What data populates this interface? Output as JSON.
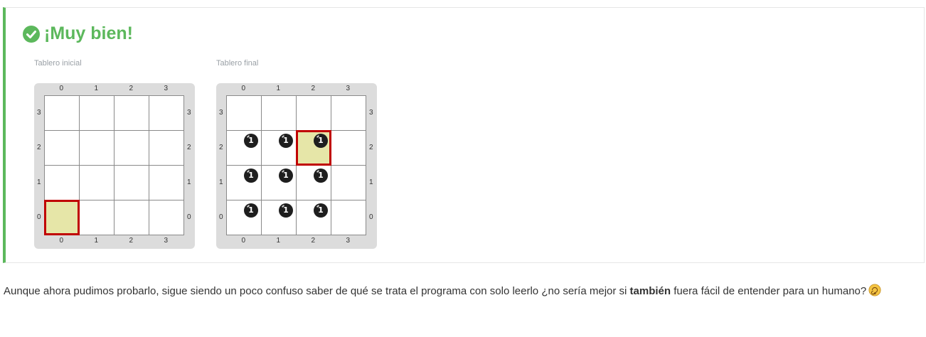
{
  "result": {
    "title": "¡Muy bien!",
    "colors": {
      "success": "#5cb85c",
      "cursor": "#c00000",
      "highlight": "#e6e6a8",
      "ball": "#1e1e1e"
    },
    "boards": [
      {
        "label": "Tablero inicial",
        "columns": [
          "0",
          "1",
          "2",
          "3"
        ],
        "rows": [
          "3",
          "2",
          "1",
          "0"
        ],
        "cursor": {
          "col": 0,
          "row": 0
        },
        "balls": []
      },
      {
        "label": "Tablero final",
        "columns": [
          "0",
          "1",
          "2",
          "3"
        ],
        "rows": [
          "3",
          "2",
          "1",
          "0"
        ],
        "cursor": {
          "col": 2,
          "row": 2
        },
        "balls": [
          {
            "col": 0,
            "row": 2,
            "count": "1"
          },
          {
            "col": 1,
            "row": 2,
            "count": "1"
          },
          {
            "col": 2,
            "row": 2,
            "count": "1"
          },
          {
            "col": 0,
            "row": 1,
            "count": "1"
          },
          {
            "col": 1,
            "row": 1,
            "count": "1"
          },
          {
            "col": 2,
            "row": 1,
            "count": "1"
          },
          {
            "col": 0,
            "row": 0,
            "count": "1"
          },
          {
            "col": 1,
            "row": 0,
            "count": "1"
          },
          {
            "col": 2,
            "row": 0,
            "count": "1"
          }
        ]
      }
    ]
  },
  "paragraph": {
    "text_before": "Aunque ahora pudimos probarlo, sigue siendo un poco confuso saber de qué se trata el programa con solo leerlo ¿no sería mejor si ",
    "bold": "también",
    "text_after": " fuera fácil de entender para un humano?",
    "emoji": "dizzy-face-icon"
  }
}
